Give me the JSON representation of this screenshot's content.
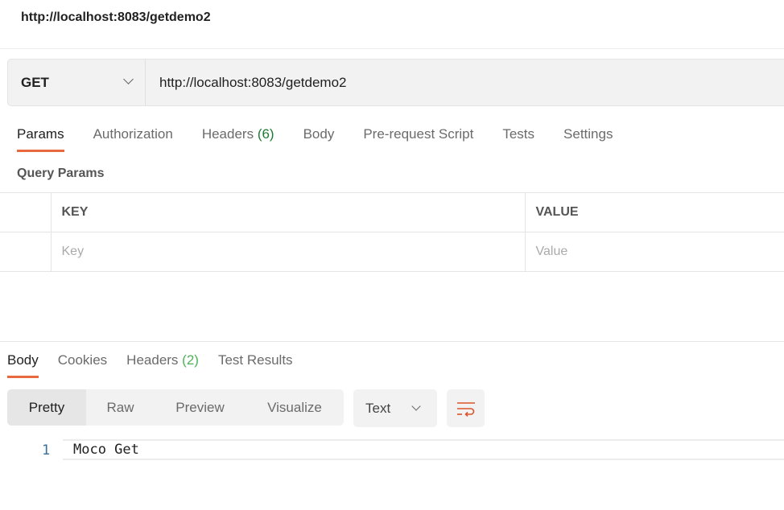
{
  "title": "http://localhost:8083/getdemo2",
  "request": {
    "method": "GET",
    "url": "http://localhost:8083/getdemo2"
  },
  "tabs": [
    {
      "label": "Params"
    },
    {
      "label": "Authorization"
    },
    {
      "label": "Headers",
      "count": "(6)"
    },
    {
      "label": "Body"
    },
    {
      "label": "Pre-request Script"
    },
    {
      "label": "Tests"
    },
    {
      "label": "Settings"
    }
  ],
  "query_params": {
    "title": "Query Params",
    "columns": [
      "KEY",
      "VALUE"
    ],
    "placeholders": [
      "Key",
      "Value"
    ]
  },
  "response": {
    "tabs": [
      {
        "label": "Body"
      },
      {
        "label": "Cookies"
      },
      {
        "label": "Headers",
        "count": "(2)"
      },
      {
        "label": "Test Results"
      }
    ],
    "views": [
      "Pretty",
      "Raw",
      "Preview",
      "Visualize"
    ],
    "format": "Text",
    "lines": [
      {
        "num": "1",
        "text": "Moco Get"
      }
    ]
  },
  "colors": {
    "accent": "#e8693e",
    "count_green": "#1f7a33"
  }
}
